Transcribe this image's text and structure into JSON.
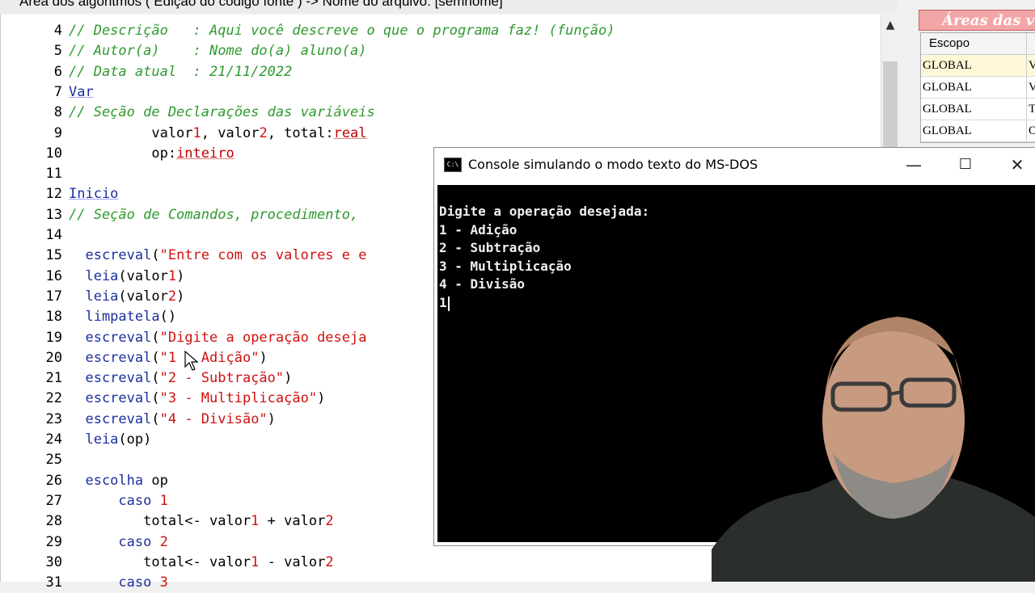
{
  "window": {
    "title": "Área dos algoritmos ( Edição do código fonte ) -> Nome do arquivo: [semnome]"
  },
  "editor": {
    "lines": [
      {
        "n": "4",
        "parts": [
          {
            "t": "// Descrição   : Aqui você descreve o que o programa faz! (função)",
            "c": "cm"
          }
        ]
      },
      {
        "n": "5",
        "parts": [
          {
            "t": "// Autor(a)    : Nome do(a) aluno(a)",
            "c": "cm"
          }
        ]
      },
      {
        "n": "6",
        "parts": [
          {
            "t": "// Data atual  : 21/11/2022",
            "c": "cm"
          }
        ]
      },
      {
        "n": "7",
        "parts": [
          {
            "t": "Var",
            "c": "kw"
          }
        ]
      },
      {
        "n": "8",
        "parts": [
          {
            "t": "// Seção de Declarações das variáveis",
            "c": "cm"
          }
        ]
      },
      {
        "n": "9",
        "parts": [
          {
            "t": "          valor",
            "c": ""
          },
          {
            "t": "1",
            "c": "num"
          },
          {
            "t": ", valor",
            "c": ""
          },
          {
            "t": "2",
            "c": "num"
          },
          {
            "t": ", total:",
            "c": ""
          },
          {
            "t": "real",
            "c": "typ"
          }
        ]
      },
      {
        "n": "10",
        "parts": [
          {
            "t": "          op:",
            "c": ""
          },
          {
            "t": "inteiro",
            "c": "typ"
          }
        ]
      },
      {
        "n": "11",
        "parts": []
      },
      {
        "n": "12",
        "parts": [
          {
            "t": "Inicio",
            "c": "kw"
          }
        ]
      },
      {
        "n": "13",
        "parts": [
          {
            "t": "// Seção de Comandos, procedimento, ",
            "c": "cm"
          }
        ]
      },
      {
        "n": "14",
        "parts": []
      },
      {
        "n": "15",
        "parts": [
          {
            "t": "  escreval",
            "c": "fn"
          },
          {
            "t": "(",
            "c": ""
          },
          {
            "t": "\"Entre com os valores e e",
            "c": "str"
          }
        ]
      },
      {
        "n": "16",
        "parts": [
          {
            "t": "  leia",
            "c": "fn"
          },
          {
            "t": "(valor",
            "c": ""
          },
          {
            "t": "1",
            "c": "num"
          },
          {
            "t": ")",
            "c": ""
          }
        ]
      },
      {
        "n": "17",
        "parts": [
          {
            "t": "  leia",
            "c": "fn"
          },
          {
            "t": "(valor",
            "c": ""
          },
          {
            "t": "2",
            "c": "num"
          },
          {
            "t": ")",
            "c": ""
          }
        ]
      },
      {
        "n": "18",
        "parts": [
          {
            "t": "  limpatela",
            "c": "fn"
          },
          {
            "t": "()",
            "c": ""
          }
        ]
      },
      {
        "n": "19",
        "parts": [
          {
            "t": "  escreval",
            "c": "fn"
          },
          {
            "t": "(",
            "c": ""
          },
          {
            "t": "\"Digite a operação deseja",
            "c": "str"
          }
        ]
      },
      {
        "n": "20",
        "parts": [
          {
            "t": "  escreval",
            "c": "fn"
          },
          {
            "t": "(",
            "c": ""
          },
          {
            "t": "\"1 - Adição\"",
            "c": "str"
          },
          {
            "t": ")",
            "c": ""
          }
        ]
      },
      {
        "n": "21",
        "parts": [
          {
            "t": "  escreval",
            "c": "fn"
          },
          {
            "t": "(",
            "c": ""
          },
          {
            "t": "\"2 - Subtração\"",
            "c": "str"
          },
          {
            "t": ")",
            "c": ""
          }
        ]
      },
      {
        "n": "22",
        "parts": [
          {
            "t": "  escreval",
            "c": "fn"
          },
          {
            "t": "(",
            "c": ""
          },
          {
            "t": "\"3 - Multiplicação\"",
            "c": "str"
          },
          {
            "t": ")",
            "c": ""
          }
        ]
      },
      {
        "n": "23",
        "parts": [
          {
            "t": "  escreval",
            "c": "fn"
          },
          {
            "t": "(",
            "c": ""
          },
          {
            "t": "\"4 - Divisão\"",
            "c": "str"
          },
          {
            "t": ")",
            "c": ""
          }
        ]
      },
      {
        "n": "24",
        "parts": [
          {
            "t": "  leia",
            "c": "fn"
          },
          {
            "t": "(op)",
            "c": ""
          }
        ]
      },
      {
        "n": "25",
        "parts": []
      },
      {
        "n": "26",
        "parts": [
          {
            "t": "  escolha",
            "c": "fn"
          },
          {
            "t": " op",
            "c": ""
          }
        ]
      },
      {
        "n": "27",
        "parts": [
          {
            "t": "      caso",
            "c": "fn"
          },
          {
            "t": " ",
            "c": ""
          },
          {
            "t": "1",
            "c": "num"
          }
        ]
      },
      {
        "n": "28",
        "parts": [
          {
            "t": "         total<- valor",
            "c": ""
          },
          {
            "t": "1",
            "c": "num"
          },
          {
            "t": " + valor",
            "c": ""
          },
          {
            "t": "2",
            "c": "num"
          }
        ]
      },
      {
        "n": "29",
        "parts": [
          {
            "t": "      caso",
            "c": "fn"
          },
          {
            "t": " ",
            "c": ""
          },
          {
            "t": "2",
            "c": "num"
          }
        ]
      },
      {
        "n": "30",
        "parts": [
          {
            "t": "         total<- valor",
            "c": ""
          },
          {
            "t": "1",
            "c": "num"
          },
          {
            "t": " - valor",
            "c": ""
          },
          {
            "t": "2",
            "c": "num"
          }
        ]
      },
      {
        "n": "31",
        "parts": [
          {
            "t": "      caso",
            "c": "fn"
          },
          {
            "t": " ",
            "c": ""
          },
          {
            "t": "3",
            "c": "num"
          }
        ]
      }
    ]
  },
  "scope_panel": {
    "title": "Áreas das v",
    "header": "Escopo",
    "rows": [
      {
        "scope": "GLOBAL",
        "col2": "V",
        "selected": true
      },
      {
        "scope": "GLOBAL",
        "col2": "V",
        "selected": false
      },
      {
        "scope": "GLOBAL",
        "col2": "T",
        "selected": false
      },
      {
        "scope": "GLOBAL",
        "col2": "O",
        "selected": false
      }
    ]
  },
  "console": {
    "title": "Console simulando o modo texto do MS-DOS",
    "icon": "console-icon",
    "minimize": "—",
    "maximize": "☐",
    "close": "✕",
    "output": [
      "Digite a operação desejada:",
      "1 - Adição",
      "2 - Subtração",
      "3 - Multiplicação",
      "4 - Divisão",
      "1"
    ]
  },
  "colors": {
    "comment": "#2e9a2e",
    "keyword": "#1c2f9e",
    "string": "#d01010",
    "console_bg": "#000000",
    "panel_title": "#f4a6a6"
  }
}
